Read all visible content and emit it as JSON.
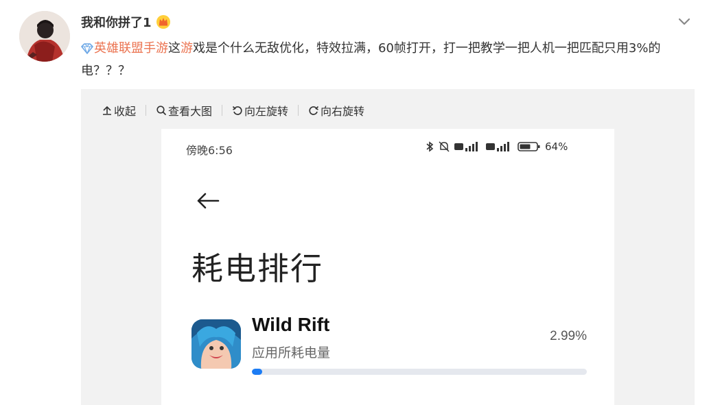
{
  "user": {
    "name": "我和你拼了1",
    "badge_icon": "crown-icon"
  },
  "post": {
    "topic": "英雄联盟手游",
    "seg1": "这",
    "seg2_link": "游",
    "seg3": "戏是个什么无敌优化，特效拉满，60帧打开，打一把教学一把人机一把匹配只用3%的电？？？"
  },
  "toolbar": {
    "collapse": "收起",
    "view_large": "查看大图",
    "rotate_left": "向左旋转",
    "rotate_right": "向右旋转"
  },
  "screenshot": {
    "status_time": "傍晚6:56",
    "battery_text": "64",
    "page_title": "耗电排行",
    "app": {
      "name": "Wild Rift",
      "subtitle": "应用所耗电量",
      "percent": "2.99%",
      "usage_fraction": 0.0299
    },
    "accent_color": "#1c7cf4",
    "topic_color": "#eb7350"
  }
}
